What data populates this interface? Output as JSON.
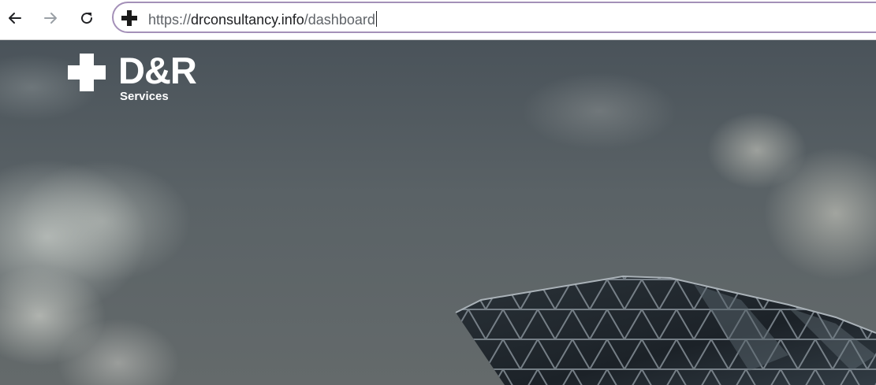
{
  "browser": {
    "url_protocol": "https://",
    "url_domain": "drconsultancy.info",
    "url_path": "/dashboard",
    "site_icon": "plus-cross-icon",
    "back_icon": "arrow-left-icon",
    "forward_icon": "arrow-right-icon",
    "reload_icon": "reload-icon"
  },
  "page": {
    "logo": {
      "wordmark": "D&R",
      "subtitle": "Services"
    }
  },
  "colors": {
    "omnibox_border": "#a490b8",
    "logo": "#ffffff",
    "sky": "#5a6266",
    "building": "#1c2228"
  }
}
